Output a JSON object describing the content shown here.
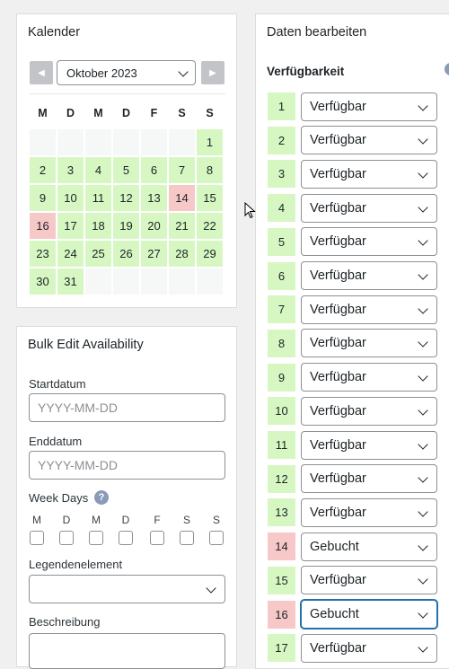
{
  "calendar": {
    "title": "Kalender",
    "month": "Oktober 2023",
    "weekdays": [
      "M",
      "D",
      "M",
      "D",
      "F",
      "S",
      "S"
    ],
    "leading_blanks": 6,
    "days": [
      {
        "d": "1",
        "s": "avail"
      },
      {
        "d": "2",
        "s": "avail"
      },
      {
        "d": "3",
        "s": "avail"
      },
      {
        "d": "4",
        "s": "avail"
      },
      {
        "d": "5",
        "s": "avail"
      },
      {
        "d": "6",
        "s": "avail"
      },
      {
        "d": "7",
        "s": "avail"
      },
      {
        "d": "8",
        "s": "avail"
      },
      {
        "d": "9",
        "s": "avail"
      },
      {
        "d": "10",
        "s": "avail"
      },
      {
        "d": "11",
        "s": "avail"
      },
      {
        "d": "12",
        "s": "avail"
      },
      {
        "d": "13",
        "s": "avail"
      },
      {
        "d": "14",
        "s": "booked"
      },
      {
        "d": "15",
        "s": "avail"
      },
      {
        "d": "16",
        "s": "booked"
      },
      {
        "d": "17",
        "s": "avail"
      },
      {
        "d": "18",
        "s": "avail"
      },
      {
        "d": "19",
        "s": "avail"
      },
      {
        "d": "20",
        "s": "avail"
      },
      {
        "d": "21",
        "s": "avail"
      },
      {
        "d": "22",
        "s": "avail"
      },
      {
        "d": "23",
        "s": "avail"
      },
      {
        "d": "24",
        "s": "avail"
      },
      {
        "d": "25",
        "s": "avail"
      },
      {
        "d": "26",
        "s": "avail"
      },
      {
        "d": "27",
        "s": "avail"
      },
      {
        "d": "28",
        "s": "avail"
      },
      {
        "d": "29",
        "s": "avail"
      },
      {
        "d": "30",
        "s": "avail"
      },
      {
        "d": "31",
        "s": "avail"
      }
    ],
    "trailing_blanks": 5
  },
  "bulk": {
    "title": "Bulk Edit Availability",
    "start_label": "Startdatum",
    "start_placeholder": "YYYY-MM-DD",
    "end_label": "Enddatum",
    "end_placeholder": "YYYY-MM-DD",
    "weekdays_label": "Week Days",
    "help_glyph": "?",
    "weekdays": [
      "M",
      "D",
      "M",
      "D",
      "F",
      "S",
      "S"
    ],
    "legend_label": "Legendenelement",
    "legend_value": "",
    "description_label": "Beschreibung"
  },
  "edit": {
    "title": "Daten bearbeiten",
    "availability_heading": "Verfügbarkeit",
    "rows": [
      {
        "day": "1",
        "status": "Verfügbar",
        "state": "avail"
      },
      {
        "day": "2",
        "status": "Verfügbar",
        "state": "avail"
      },
      {
        "day": "3",
        "status": "Verfügbar",
        "state": "avail"
      },
      {
        "day": "4",
        "status": "Verfügbar",
        "state": "avail"
      },
      {
        "day": "5",
        "status": "Verfügbar",
        "state": "avail"
      },
      {
        "day": "6",
        "status": "Verfügbar",
        "state": "avail"
      },
      {
        "day": "7",
        "status": "Verfügbar",
        "state": "avail"
      },
      {
        "day": "8",
        "status": "Verfügbar",
        "state": "avail"
      },
      {
        "day": "9",
        "status": "Verfügbar",
        "state": "avail"
      },
      {
        "day": "10",
        "status": "Verfügbar",
        "state": "avail"
      },
      {
        "day": "11",
        "status": "Verfügbar",
        "state": "avail"
      },
      {
        "day": "12",
        "status": "Verfügbar",
        "state": "avail"
      },
      {
        "day": "13",
        "status": "Verfügbar",
        "state": "avail"
      },
      {
        "day": "14",
        "status": "Gebucht",
        "state": "booked"
      },
      {
        "day": "15",
        "status": "Verfügbar",
        "state": "avail"
      },
      {
        "day": "16",
        "status": "Gebucht",
        "state": "booked",
        "focused": true
      },
      {
        "day": "17",
        "status": "Verfügbar",
        "state": "avail"
      }
    ]
  },
  "colors": {
    "available": "#d7f7c2",
    "booked": "#f6c8c8",
    "empty": "#f6f7f7",
    "focus": "#2271b1"
  }
}
